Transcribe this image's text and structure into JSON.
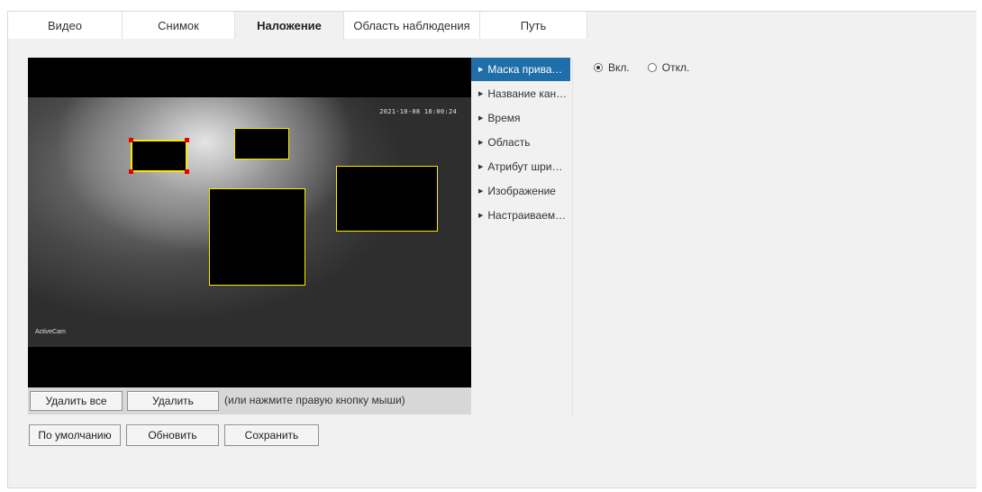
{
  "tabs": [
    {
      "label": "Видео",
      "active": false
    },
    {
      "label": "Снимок",
      "active": false
    },
    {
      "label": "Наложение",
      "active": true
    },
    {
      "label": "Область наблюдения",
      "active": false
    },
    {
      "label": "Путь",
      "active": false
    }
  ],
  "video": {
    "timestamp": "2021-10-08 18:00:24",
    "camera_name": "ActiveCam"
  },
  "mask_toolbar": {
    "delete_all_label": "Удалить все",
    "delete_label": "Удалить",
    "hint": "(или нажмите правую кнопку мыши)"
  },
  "footer_buttons": {
    "default_label": "По умолчанию",
    "refresh_label": "Обновить",
    "save_label": "Сохранить"
  },
  "menu": {
    "items": [
      {
        "label": "Маска приватности",
        "active": true
      },
      {
        "label": "Название канала",
        "active": false
      },
      {
        "label": "Время",
        "active": false
      },
      {
        "label": "Область",
        "active": false
      },
      {
        "label": "Атрибут шрифта",
        "active": false
      },
      {
        "label": "Изображение",
        "active": false
      },
      {
        "label": "Настраиваемое",
        "active": false
      }
    ]
  },
  "privacy_mask": {
    "on_label": "Вкл.",
    "off_label": "Откл.",
    "selected": "on"
  },
  "colors": {
    "accent": "#1f6ea8",
    "mask_border": "#ffe600",
    "handle": "#e60000"
  }
}
